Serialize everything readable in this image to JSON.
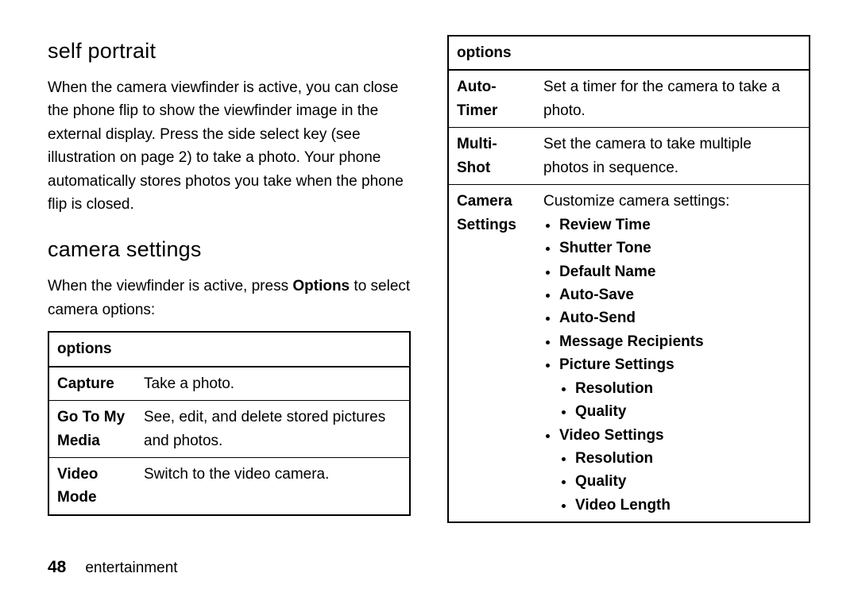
{
  "left": {
    "h1": "self portrait",
    "p1": "When the camera viewfinder is active, you can close the phone flip to show the viewfinder image in the external display. Press the side select key (see illustration on page 2) to take a photo. Your phone automatically stores photos you take when the phone flip is closed.",
    "h2": "camera settings",
    "p2a": "When the viewfinder is active, press ",
    "p2b": "Options",
    "p2c": " to select camera options:",
    "table": {
      "header": "options",
      "rows": [
        {
          "k": "Capture",
          "v": "Take a photo."
        },
        {
          "k": "Go To My Media",
          "v": "See, edit, and delete stored pictures and photos."
        },
        {
          "k": "Video Mode",
          "v": "Switch to the video camera."
        }
      ]
    }
  },
  "right": {
    "table": {
      "header": "options",
      "rows": [
        {
          "k": "Auto-Timer",
          "v": "Set a timer for the camera to take a photo."
        },
        {
          "k": "Multi-Shot",
          "v": "Set the camera to take multiple photos in sequence."
        },
        {
          "k": "Camera Settings",
          "vlead": "Customize camera settings:",
          "bullets": {
            "b0": "Review Time",
            "b1": "Shutter Tone",
            "b2": "Default Name",
            "b3": "Auto-Save",
            "b4": "Auto-Send",
            "b5": "Message Recipients",
            "b6": "Picture Settings",
            "b6a": "Resolution",
            "b6b": "Quality",
            "b7": "Video Settings",
            "b7a": "Resolution",
            "b7b": "Quality",
            "b7c": "Video Length"
          }
        }
      ]
    }
  },
  "footer": {
    "page": "48",
    "section": "entertainment"
  }
}
